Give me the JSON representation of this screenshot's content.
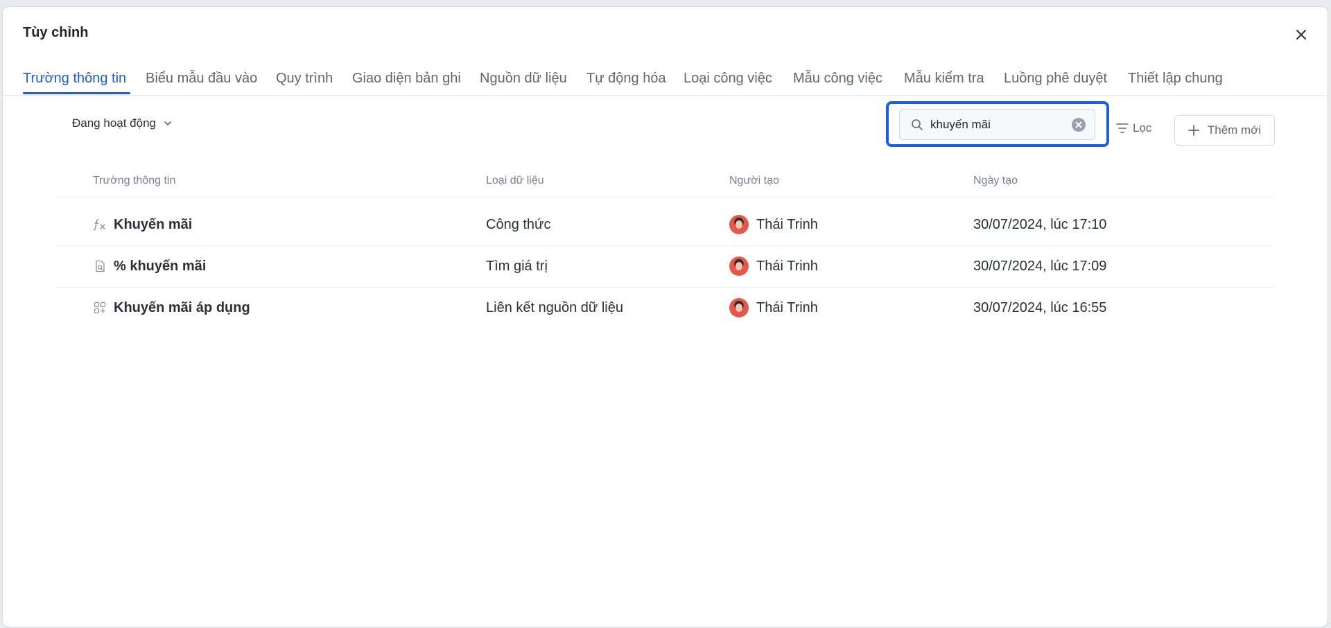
{
  "modal": {
    "title": "Tùy chỉnh"
  },
  "tabs": [
    {
      "label": "Trường thông tin",
      "active": true
    },
    {
      "label": "Biểu mẫu đầu vào"
    },
    {
      "label": "Quy trình"
    },
    {
      "label": "Giao diện bản ghi"
    },
    {
      "label": "Nguồn dữ liệu"
    },
    {
      "label": "Tự động hóa"
    },
    {
      "label": "Loại công việc"
    },
    {
      "label": "Mẫu công việc"
    },
    {
      "label": "Mẫu kiểm tra"
    },
    {
      "label": "Luồng phê duyệt"
    },
    {
      "label": "Thiết lập chung"
    }
  ],
  "toolbar": {
    "status_filter": "Đang hoạt động",
    "search_value": "khuyến mãi",
    "filter_label": "Lọc",
    "add_label": "Thêm mới"
  },
  "table": {
    "columns": [
      "Trường thông tin",
      "Loại dữ liệu",
      "Người tạo",
      "Ngày tạo"
    ],
    "rows": [
      {
        "icon": "formula-icon",
        "name": "Khuyến mãi",
        "type": "Công thức",
        "creator": "Thái Trinh",
        "created": "30/07/2024, lúc 17:10"
      },
      {
        "icon": "lookup-icon",
        "name": "% khuyến mãi",
        "type": "Tìm giá trị",
        "creator": "Thái Trinh",
        "created": "30/07/2024, lúc 17:09"
      },
      {
        "icon": "linked-source-icon",
        "name": "Khuyến mãi áp dụng",
        "type": "Liên kết nguồn dữ liệu",
        "creator": "Thái Trinh",
        "created": "30/07/2024, lúc 16:55"
      }
    ]
  },
  "colors": {
    "accent": "#1d5bd6",
    "focus_ring": "#1a5fe0"
  }
}
